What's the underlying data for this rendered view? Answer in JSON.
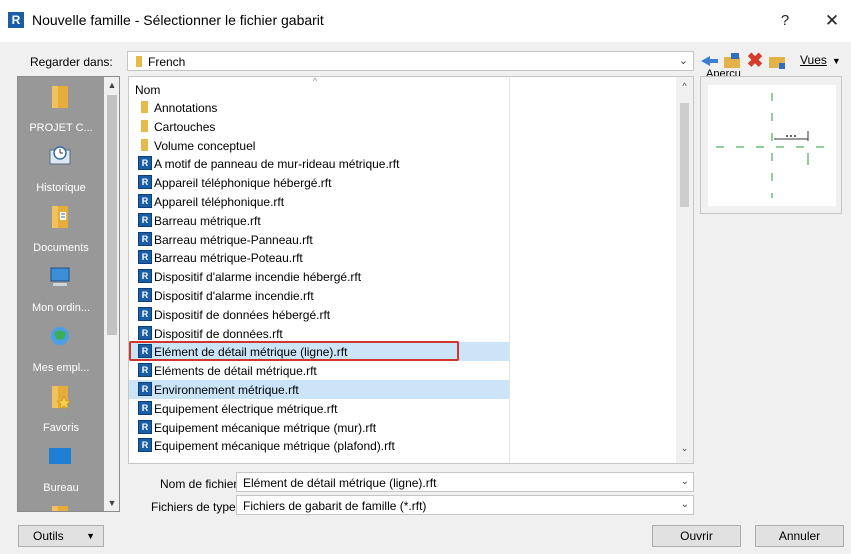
{
  "window": {
    "app_icon": "R",
    "title": "Nouvelle famille - Sélectionner le fichier gabarit",
    "help_label": "?",
    "close_label": "✕"
  },
  "lookin": {
    "label": "Regarder dans:",
    "value": "French"
  },
  "toolbar": {
    "views_label": "Vues",
    "icons": [
      "back-arrow-icon",
      "up-folder-icon",
      "delete-icon",
      "new-folder-icon"
    ]
  },
  "places": {
    "items": [
      {
        "label": "PROJET C...",
        "icon": "folder-icon"
      },
      {
        "label": "Historique",
        "icon": "history-icon"
      },
      {
        "label": "Documents",
        "icon": "documents-icon"
      },
      {
        "label": "Mon ordin...",
        "icon": "computer-icon"
      },
      {
        "label": "Mes empl...",
        "icon": "network-places-icon"
      },
      {
        "label": "Favoris",
        "icon": "favorites-icon"
      },
      {
        "label": "Bureau",
        "icon": "desktop-icon"
      }
    ]
  },
  "filelist": {
    "column_name": "Nom",
    "items": [
      {
        "name": "Annotations",
        "type": "folder"
      },
      {
        "name": "Cartouches",
        "type": "folder"
      },
      {
        "name": "Volume conceptuel",
        "type": "folder"
      },
      {
        "name": "A motif de panneau de mur-rideau métrique.rft",
        "type": "rft"
      },
      {
        "name": "Appareil téléphonique hébergé.rft",
        "type": "rft"
      },
      {
        "name": "Appareil téléphonique.rft",
        "type": "rft"
      },
      {
        "name": "Barreau métrique.rft",
        "type": "rft"
      },
      {
        "name": "Barreau métrique-Panneau.rft",
        "type": "rft"
      },
      {
        "name": "Barreau métrique-Poteau.rft",
        "type": "rft"
      },
      {
        "name": "Dispositif d'alarme incendie hébergé.rft",
        "type": "rft"
      },
      {
        "name": "Dispositif d'alarme incendie.rft",
        "type": "rft"
      },
      {
        "name": "Dispositif de données hébergé.rft",
        "type": "rft"
      },
      {
        "name": "Dispositif de données.rft",
        "type": "rft"
      },
      {
        "name": "Elément de détail métrique (ligne).rft",
        "type": "rft"
      },
      {
        "name": "Eléments de détail métrique.rft",
        "type": "rft"
      },
      {
        "name": "Environnement métrique.rft",
        "type": "rft"
      },
      {
        "name": "Equipement électrique métrique.rft",
        "type": "rft"
      },
      {
        "name": "Equipement mécanique métrique (mur).rft",
        "type": "rft"
      },
      {
        "name": "Equipement mécanique métrique (plafond).rft",
        "type": "rft"
      }
    ]
  },
  "preview": {
    "label": "Aperçu"
  },
  "filename": {
    "label": "Nom de fichier:",
    "value": "Elément de détail métrique (ligne).rft"
  },
  "filetype": {
    "label": "Fichiers de type:",
    "value": "Fichiers de gabarit de famille  (*.rft)"
  },
  "buttons": {
    "tools": "Outils",
    "open": "Ouvrir",
    "cancel": "Annuler"
  },
  "colors": {
    "selection": "#cce4f7",
    "highlight_border": "#d2352d",
    "places_bg": "#989898",
    "preview_green": "#2a9b3a"
  }
}
